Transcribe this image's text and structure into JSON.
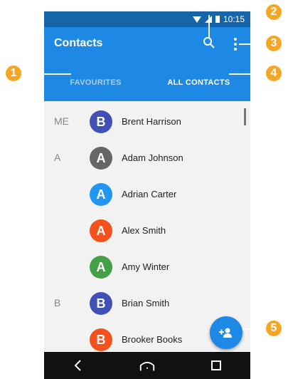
{
  "status_bar": {
    "time": "10:15"
  },
  "app_bar": {
    "title": "Contacts",
    "search_icon": "search-icon",
    "more_icon": "more-vert-icon"
  },
  "tabs": [
    {
      "label": "FAVOURITES",
      "selected": false
    },
    {
      "label": "ALL CONTACTS",
      "selected": true
    }
  ],
  "contacts": [
    {
      "section": "ME",
      "initial": "B",
      "name": "Brent Harrison",
      "color": "#3f51b5"
    },
    {
      "section": "A",
      "initial": "A",
      "name": "Adam Johnson",
      "color": "#666666"
    },
    {
      "section": "",
      "initial": "A",
      "name": "Adrian Carter",
      "color": "#2196f3"
    },
    {
      "section": "",
      "initial": "A",
      "name": "Alex Smith",
      "color": "#f4511e"
    },
    {
      "section": "",
      "initial": "A",
      "name": "Amy Winter",
      "color": "#43a047"
    },
    {
      "section": "B",
      "initial": "B",
      "name": "Brian Smith",
      "color": "#3f51b5"
    },
    {
      "section": "",
      "initial": "B",
      "name": "Brooker Books",
      "color": "#f4511e"
    }
  ],
  "fab": {
    "icon": "add-person-icon"
  },
  "callouts": [
    "1",
    "2",
    "3",
    "4",
    "5"
  ],
  "colors": {
    "primary": "#1e88e5",
    "status_bar": "#1565a8",
    "callout": "#f5a623"
  }
}
